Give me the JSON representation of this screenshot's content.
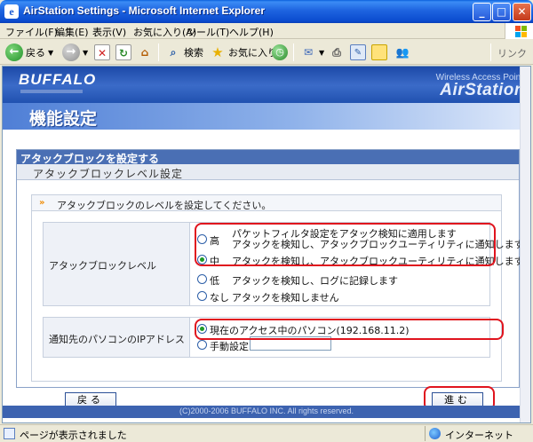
{
  "window": {
    "title": "AirStation Settings - Microsoft Internet Explorer",
    "min_label": "_",
    "max_label": "□",
    "close_label": "✕"
  },
  "menu": [
    "ファイル(F)",
    "編集(E)",
    "表示(V)",
    "お気に入り(A)",
    "ツール(T)",
    "ヘルプ(H)"
  ],
  "toolbar": {
    "back_label": "戻る",
    "search_label": "検索",
    "favorites_label": "お気に入り",
    "links_label": "リンク"
  },
  "header": {
    "brand": "BUFFALO",
    "product_line": "Wireless Access Point",
    "product": "AirStation"
  },
  "page_title": "機能設定",
  "panel": {
    "title": "アタックブロックを設定する",
    "subtitle": "アタックブロックレベル設定",
    "instruction": "アタックブロックのレベルを設定してください。"
  },
  "level": {
    "label": "アタックブロックレベル",
    "options": [
      {
        "key": "高",
        "desc1": "パケットフィルタ設定をアタック検知に適用します",
        "desc2": "アタックを検知し、アタックブロックユーティリティに通知します",
        "selected": false
      },
      {
        "key": "中",
        "desc1": "アタックを検知し、アタックブロックユーティリティに通知します",
        "selected": true
      },
      {
        "key": "低",
        "desc1": "アタックを検知し、ログに記録します",
        "selected": false
      },
      {
        "key": "なし",
        "desc1": "アタックを検知しません",
        "selected": false
      }
    ]
  },
  "notify": {
    "label": "通知先のパソコンのIPアドレス",
    "current_option": "現在のアクセス中のパソコン(192.168.11.2)",
    "manual_option": "手動設定",
    "manual_value": ""
  },
  "buttons": {
    "back": "戻る",
    "next": "進む"
  },
  "footer": "(C)2000-2006 BUFFALO INC. All rights reserved.",
  "status": {
    "message": "ページが表示されました",
    "zone": "インターネット"
  }
}
